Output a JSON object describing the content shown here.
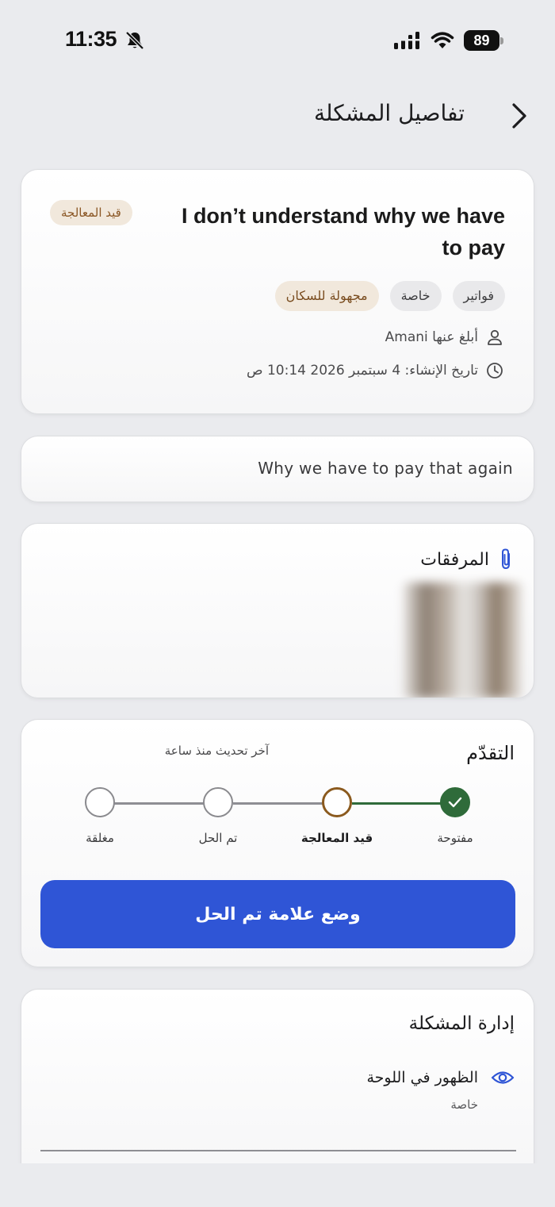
{
  "status_bar": {
    "time": "11:35",
    "battery": "89",
    "icons": [
      "bell-slash-icon",
      "signal-icon",
      "wifi-icon",
      "battery-icon"
    ]
  },
  "header": {
    "title": "تفاصيل المشكلة",
    "back_icon": "chevron-icon"
  },
  "issue": {
    "title": "I don’t understand why we have to pay",
    "status_badge": "قيد المعالجة",
    "tags": [
      "فواتير",
      "خاصة",
      "مجهولة للسكان"
    ],
    "reporter": "أبلغ عنها Amani",
    "created": "تاريخ الإنشاء: 4 سبتمبر 2026 10:14 ص",
    "description": "Why we have to pay that again"
  },
  "attachments": {
    "label": "المرفقات",
    "icon": "paperclip-icon"
  },
  "progress": {
    "title": "التقدّم",
    "last_update": "آخر تحديث منذ ساعة",
    "steps": [
      "مفتوحة",
      "قيد المعالجة",
      "تم الحل",
      "مغلقة"
    ],
    "current_step": 2,
    "button_label": "وضع علامة تم الحل"
  },
  "management": {
    "title": "إدارة المشكلة",
    "visibility_label": "الظهور في اللوحة",
    "visibility_value": "خاصة"
  },
  "colors": {
    "accent_blue": "#2f55d6",
    "done_green": "#2f6b3a",
    "in_progress_brown": "#8b5a1e",
    "badge_bg": "#f1e8dc"
  }
}
